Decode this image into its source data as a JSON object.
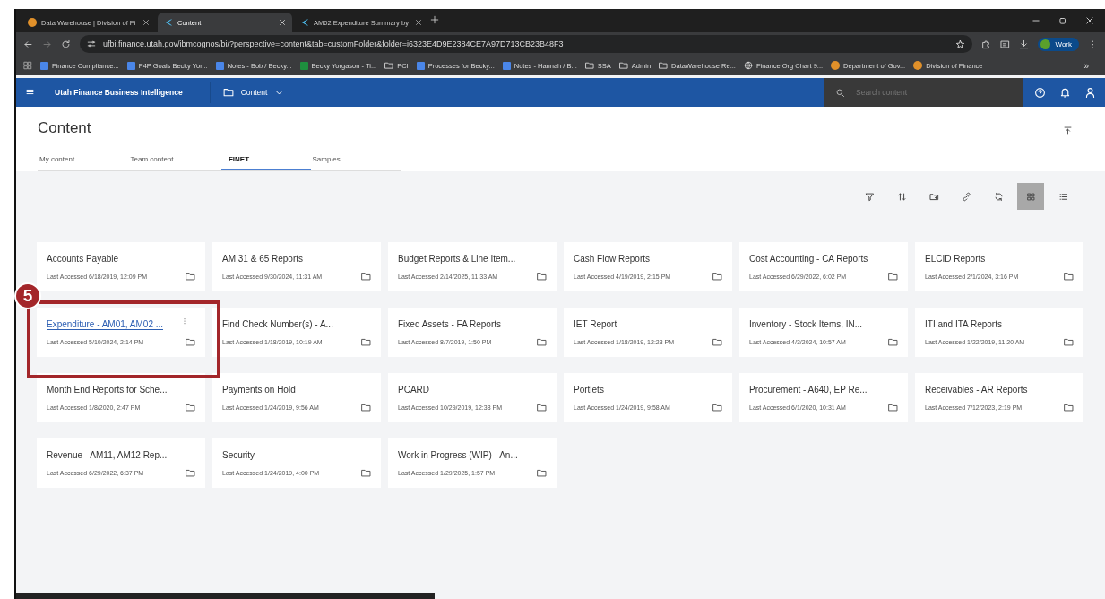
{
  "browser": {
    "tabs": [
      {
        "title": "Data Warehouse | Division of Fi",
        "selected": false
      },
      {
        "title": "Content",
        "selected": true
      },
      {
        "title": "AM02 Expenditure Summary by",
        "selected": false
      }
    ],
    "url": "ufbi.finance.utah.gov/ibmcognos/bi/?perspective=content&tab=customFolder&folder=i6323E4D9E2384CE7A97D713CB23B48F3",
    "profile": "Work",
    "bookmarks": [
      {
        "label": "Finance Compliance...",
        "kind": "doc"
      },
      {
        "label": "P4P Goals Becky Yor...",
        "kind": "doc"
      },
      {
        "label": "Notes - Bob / Becky...",
        "kind": "doc"
      },
      {
        "label": "Becky Yorgason - Ti...",
        "kind": "sheet"
      },
      {
        "label": "PCI",
        "kind": "folder"
      },
      {
        "label": "Processes for Becky...",
        "kind": "doc"
      },
      {
        "label": "Notes - Hannah / B...",
        "kind": "doc"
      },
      {
        "label": "SSA",
        "kind": "folder"
      },
      {
        "label": "Admin",
        "kind": "folder"
      },
      {
        "label": "DataWarehouse Re...",
        "kind": "folder"
      },
      {
        "label": "Finance Org Chart 9...",
        "kind": "globe"
      },
      {
        "label": "Department of Gov...",
        "kind": "seal"
      },
      {
        "label": "Division of Finance",
        "kind": "seal"
      }
    ],
    "more": "»"
  },
  "app": {
    "title": "Utah Finance Business Intelligence",
    "location": "Content",
    "search": {
      "placeholder": "Search content"
    }
  },
  "page": {
    "heading": "Content",
    "tabs": [
      {
        "label": "My content",
        "selected": false
      },
      {
        "label": "Team content",
        "selected": false
      },
      {
        "label": "FINET",
        "selected": true
      },
      {
        "label": "Samples",
        "selected": false
      }
    ],
    "toolbar": [
      {
        "kind": "filter",
        "selected": false
      },
      {
        "kind": "sort",
        "selected": false
      },
      {
        "kind": "folder",
        "selected": false
      },
      {
        "kind": "link",
        "selected": false
      },
      {
        "kind": "refresh",
        "selected": false
      },
      {
        "kind": "grid",
        "selected": true
      },
      {
        "kind": "list",
        "selected": false
      }
    ],
    "folders": [
      {
        "title": "Accounts Payable",
        "accessed": "Last Accessed 6/18/2019, 12:09 PM",
        "hovered": false
      },
      {
        "title": "AM 31 & 65 Reports",
        "accessed": "Last Accessed 9/30/2024, 11:31 AM",
        "hovered": false
      },
      {
        "title": "Budget Reports & Line Item...",
        "accessed": "Last Accessed 2/14/2025, 11:33 AM",
        "hovered": false
      },
      {
        "title": "Cash Flow Reports",
        "accessed": "Last Accessed 4/19/2019, 2:15 PM",
        "hovered": false
      },
      {
        "title": "Cost Accounting - CA Reports",
        "accessed": "Last Accessed 6/29/2022, 6:02 PM",
        "hovered": false
      },
      {
        "title": "ELCID Reports",
        "accessed": "Last Accessed 2/1/2024, 3:16 PM",
        "hovered": false
      },
      {
        "title": "Expenditure - AM01, AM02 ...",
        "accessed": "Last Accessed 5/10/2024, 2:14 PM",
        "hovered": true
      },
      {
        "title": "Find Check Number(s) - A...",
        "accessed": "Last Accessed 1/18/2019, 10:19 AM",
        "hovered": false
      },
      {
        "title": "Fixed Assets - FA Reports",
        "accessed": "Last Accessed 8/7/2019, 1:50 PM",
        "hovered": false
      },
      {
        "title": "IET Report",
        "accessed": "Last Accessed 1/18/2019, 12:23 PM",
        "hovered": false
      },
      {
        "title": "Inventory - Stock Items, IN...",
        "accessed": "Last Accessed 4/3/2024, 10:57 AM",
        "hovered": false
      },
      {
        "title": "ITI and ITA Reports",
        "accessed": "Last Accessed 1/22/2019, 11:20 AM",
        "hovered": false
      },
      {
        "title": "Month End Reports for Sche...",
        "accessed": "Last Accessed 1/8/2020, 2:47 PM",
        "hovered": false
      },
      {
        "title": "Payments on Hold",
        "accessed": "Last Accessed 1/24/2019, 9:56 AM",
        "hovered": false
      },
      {
        "title": "PCARD",
        "accessed": "Last Accessed 10/29/2019, 12:38 PM",
        "hovered": false
      },
      {
        "title": "Portlets",
        "accessed": "Last Accessed 1/24/2019, 9:58 AM",
        "hovered": false
      },
      {
        "title": "Procurement - A640, EP Re...",
        "accessed": "Last Accessed 6/1/2020, 10:31 AM",
        "hovered": false
      },
      {
        "title": "Receivables - AR Reports",
        "accessed": "Last Accessed 7/12/2023, 2:19 PM",
        "hovered": false
      },
      {
        "title": "Revenue - AM11, AM12 Rep...",
        "accessed": "Last Accessed 6/29/2022, 6:37 PM",
        "hovered": false
      },
      {
        "title": "Security",
        "accessed": "Last Accessed 1/24/2019, 4:00 PM",
        "hovered": false
      },
      {
        "title": "Work in Progress (WIP) - An...",
        "accessed": "Last Accessed 1/29/2025, 1:57 PM",
        "hovered": false
      }
    ]
  },
  "callout": {
    "number": "5"
  }
}
